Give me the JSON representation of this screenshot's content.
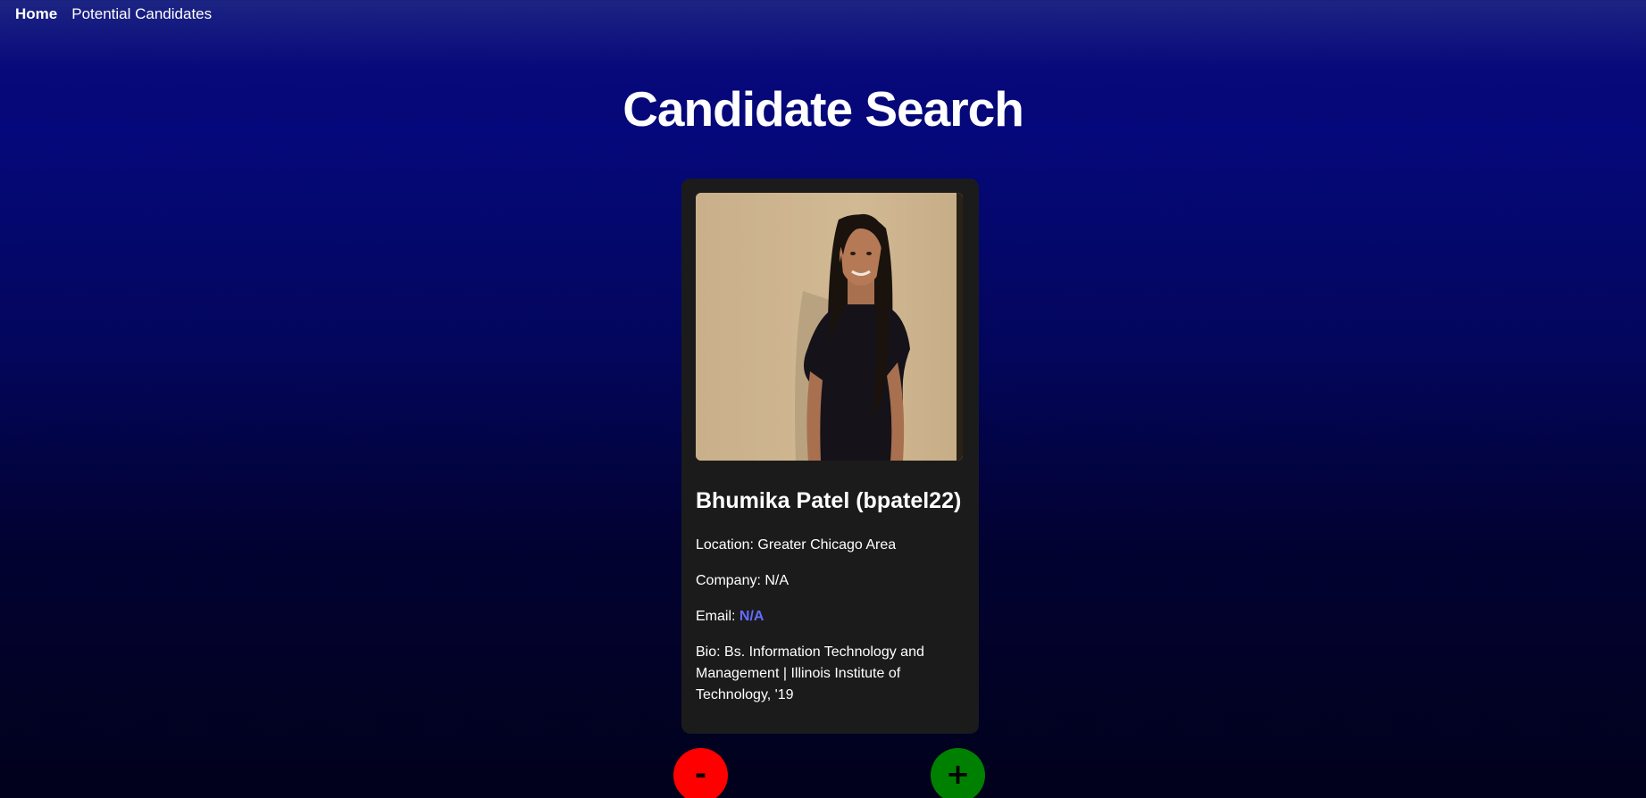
{
  "nav": {
    "home": "Home",
    "potential_candidates": "Potential Candidates"
  },
  "page": {
    "title": "Candidate Search"
  },
  "candidate": {
    "name": "Bhumika Patel (bpatel22)",
    "location_label": "Location: ",
    "location": "Greater Chicago Area",
    "company_label": "Company: ",
    "company": "N/A",
    "email_label": "Email: ",
    "email": "N/A",
    "bio_label": "Bio: ",
    "bio": "Bs. Information Technology and Management | Illinois Institute of Technology, '19",
    "avatar_icon": "candidate-photo"
  },
  "actions": {
    "reject_label": "-",
    "accept_label": "+"
  },
  "colors": {
    "reject": "#ff0000",
    "accept": "#008000",
    "link": "#646cff",
    "card_bg": "#1b1b1b"
  }
}
